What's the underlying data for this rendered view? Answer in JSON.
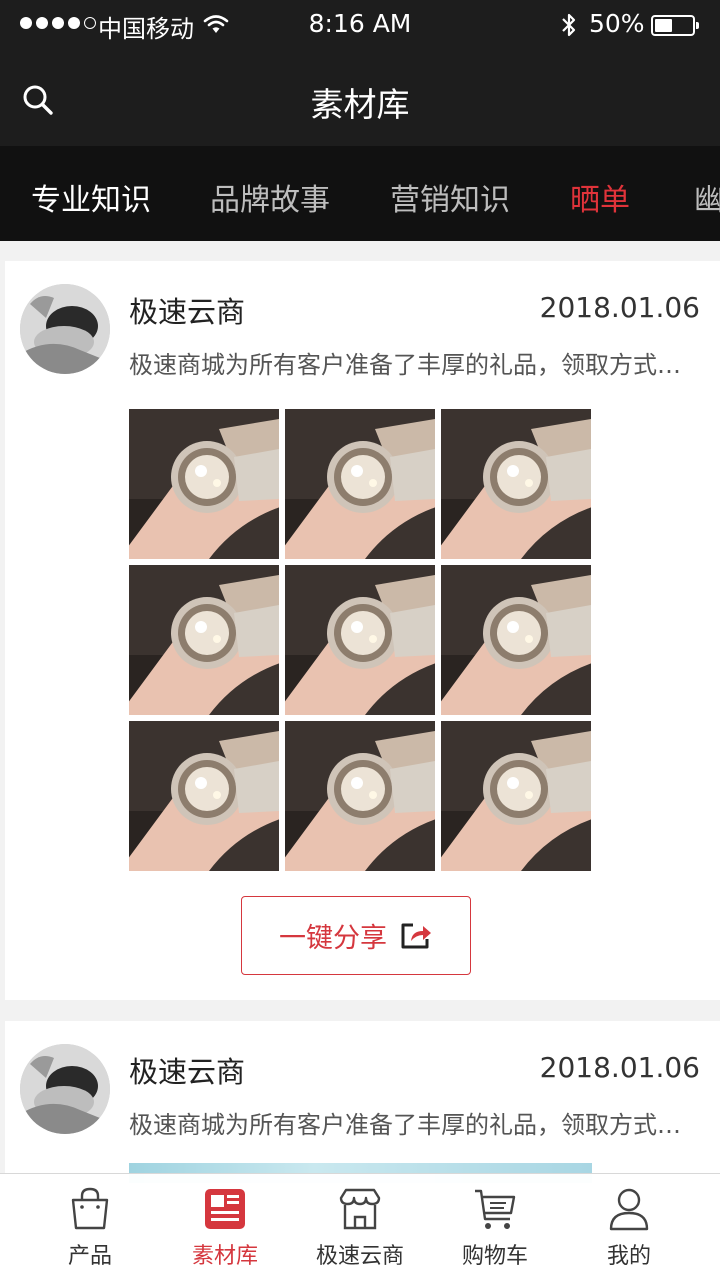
{
  "status_bar": {
    "carrier": "中国移动",
    "time": "8:16 AM",
    "battery": "50%"
  },
  "header": {
    "title": "素材库"
  },
  "tabs": [
    {
      "label": "专业知识"
    },
    {
      "label": "品牌故事"
    },
    {
      "label": "营销知识"
    },
    {
      "label": "晒单"
    },
    {
      "label": "幽"
    }
  ],
  "posts": [
    {
      "author": "极速云商",
      "date": "2018.01.06",
      "text": "极速商城为所有客户准备了丰厚的礼品，领取方式请咨询客服",
      "share_label": "一键分享"
    },
    {
      "author": "极速云商",
      "date": "2018.01.06",
      "text": "极速商城为所有客户准备了丰厚的礼品，领取方式请咨询客服"
    }
  ],
  "bottom_nav": [
    {
      "label": "产品",
      "icon": "shopping-bag-icon"
    },
    {
      "label": "素材库",
      "icon": "news-icon"
    },
    {
      "label": "极速云商",
      "icon": "store-icon"
    },
    {
      "label": "购物车",
      "icon": "cart-icon"
    },
    {
      "label": "我的",
      "icon": "user-icon"
    }
  ],
  "colors": {
    "accent": "#d5373e",
    "header_bg": "#1d1d1d",
    "tabs_bg": "#111111"
  }
}
